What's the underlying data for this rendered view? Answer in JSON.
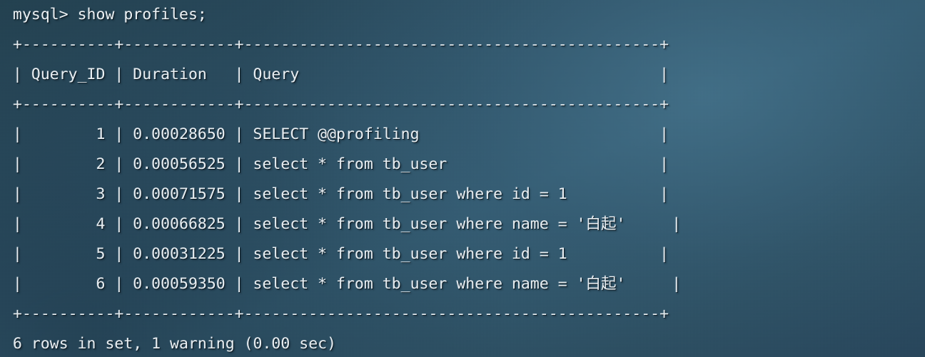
{
  "terminal": {
    "shell_prompt": "mysql>",
    "command": "show profiles;",
    "prompt_line": "mysql> show profiles;",
    "rule_line": "+----------+------------+---------------------------------------------+",
    "header_line": "| Query_ID | Duration   | Query                                       |",
    "status_line": "6 rows in set, 1 warning (0.00 sec)",
    "colors": {
      "background": "#2b4d62",
      "background_dark": "#22404f",
      "background_light": "#31586e",
      "text": "#eaf0f4",
      "text_shadow": "#08141c"
    },
    "table": {
      "columns": [
        "Query_ID",
        "Duration",
        "Query"
      ],
      "row_count": 6,
      "rows": [
        {
          "query_id": "1",
          "duration": "0.00028650",
          "query": "SELECT @@profiling",
          "line": "|        1 | 0.00028650 | SELECT @@profiling                          |"
        },
        {
          "query_id": "2",
          "duration": "0.00056525",
          "query": "select * from tb_user",
          "line": "|        2 | 0.00056525 | select * from tb_user                       |"
        },
        {
          "query_id": "3",
          "duration": "0.00071575",
          "query": "select * from tb_user where id = 1",
          "line": "|        3 | 0.00071575 | select * from tb_user where id = 1          |"
        },
        {
          "query_id": "4",
          "duration": "0.00066825",
          "query": "select * from tb_user where name = '白起'",
          "line": "|        4 | 0.00066825 | select * from tb_user where name = '白起'     |"
        },
        {
          "query_id": "5",
          "duration": "0.00031225",
          "query": "select * from tb_user where id = 1",
          "line": "|        5 | 0.00031225 | select * from tb_user where id = 1          |"
        },
        {
          "query_id": "6",
          "duration": "0.00059350",
          "query": "select * from tb_user where name = '白起'",
          "line": "|        6 | 0.00059350 | select * from tb_user where name = '白起'     |"
        }
      ]
    },
    "lines": [
      {
        "id": "prompt",
        "kind": "prompt",
        "text": "mysql> show profiles;"
      },
      {
        "id": "rule-top",
        "kind": "sep",
        "text": "+----------+------------+---------------------------------------------+"
      },
      {
        "id": "header",
        "kind": "header",
        "text": "| Query_ID | Duration   | Query                                       |"
      },
      {
        "id": "rule-mid",
        "kind": "sep",
        "text": "+----------+------------+---------------------------------------------+"
      },
      {
        "id": "row-1",
        "kind": "row",
        "text": "|        1 | 0.00028650 | SELECT @@profiling                          |"
      },
      {
        "id": "row-2",
        "kind": "row",
        "text": "|        2 | 0.00056525 | select * from tb_user                       |"
      },
      {
        "id": "row-3",
        "kind": "row",
        "text": "|        3 | 0.00071575 | select * from tb_user where id = 1          |"
      },
      {
        "id": "row-4",
        "kind": "row",
        "text": "|        4 | 0.00066825 | select * from tb_user where name = '白起'     |"
      },
      {
        "id": "row-5",
        "kind": "row",
        "text": "|        5 | 0.00031225 | select * from tb_user where id = 1          |"
      },
      {
        "id": "row-6",
        "kind": "row",
        "text": "|        6 | 0.00059350 | select * from tb_user where name = '白起'     |"
      },
      {
        "id": "rule-bottom",
        "kind": "sep",
        "text": "+----------+------------+---------------------------------------------+"
      },
      {
        "id": "status",
        "kind": "status",
        "text": "6 rows in set, 1 warning (0.00 sec)"
      }
    ]
  }
}
